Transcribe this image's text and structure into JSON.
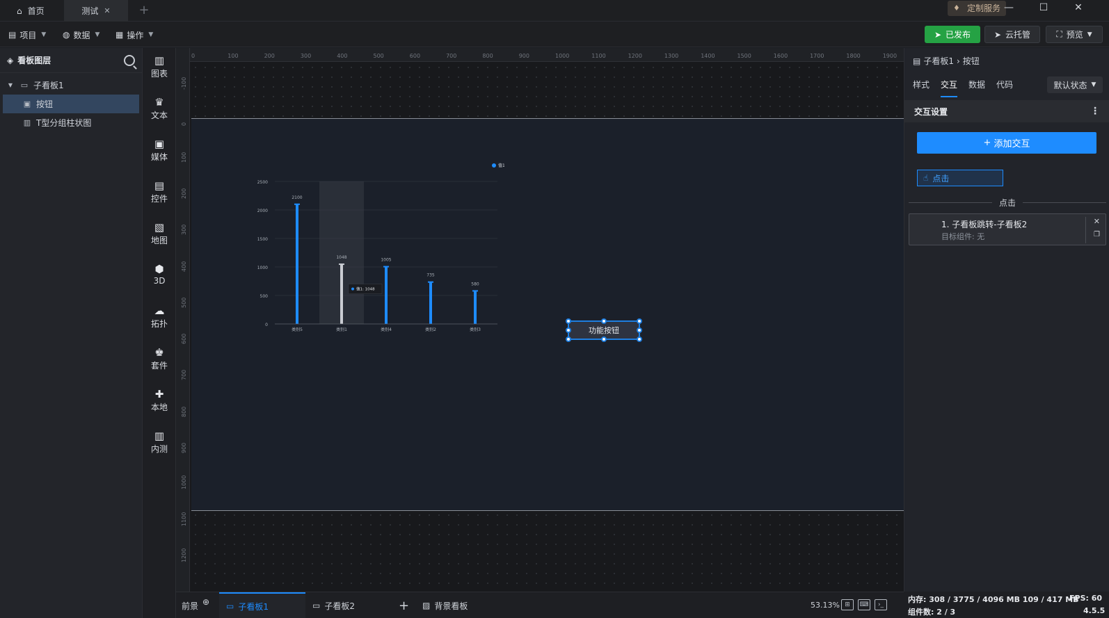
{
  "titlebar": {
    "home_tab": "首页",
    "active_tab": "测试",
    "close_glyph": "✕",
    "add_glyph": "+",
    "service_badge": "定制服务",
    "minimize_glyph": "—",
    "maximize_glyph": "☐",
    "close_window_glyph": "✕"
  },
  "toolbar": {
    "project": "项目",
    "data": "数据",
    "operate": "操作",
    "published": "已发布",
    "cloud": "云托管",
    "preview": "预览"
  },
  "layers": {
    "title": "看板图层",
    "items": [
      {
        "label": "子看板1",
        "level": 0
      },
      {
        "label": "按钮",
        "level": 1,
        "selected": true
      },
      {
        "label": "T型分组柱状图",
        "level": 1
      }
    ]
  },
  "rail": {
    "items": [
      {
        "label": "图表",
        "icon": "bar-chart-icon"
      },
      {
        "label": "文本",
        "icon": "text-icon"
      },
      {
        "label": "媒体",
        "icon": "media-icon"
      },
      {
        "label": "控件",
        "icon": "widget-icon"
      },
      {
        "label": "地图",
        "icon": "map-icon"
      },
      {
        "label": "3D",
        "icon": "cube-icon"
      },
      {
        "label": "拓扑",
        "icon": "topology-icon"
      },
      {
        "label": "套件",
        "icon": "kit-icon"
      },
      {
        "label": "本地",
        "icon": "puzzle-icon"
      },
      {
        "label": "内测",
        "icon": "beta-chart-icon"
      }
    ]
  },
  "ruler": {
    "top": [
      "0",
      "100",
      "200",
      "300",
      "400",
      "500",
      "600",
      "700",
      "800",
      "900",
      "1000",
      "1100",
      "1200",
      "1300",
      "1400",
      "1500",
      "1600",
      "1700",
      "1800",
      "1900"
    ],
    "left": [
      "-100",
      "0",
      "100",
      "200",
      "300",
      "400",
      "500",
      "600",
      "700",
      "800",
      "900",
      "1000",
      "1100",
      "1200"
    ]
  },
  "chart_data": {
    "type": "bar",
    "categories": [
      "类别5",
      "类别1",
      "类别4",
      "类别2",
      "类别3"
    ],
    "series": [
      {
        "name": "值1",
        "values": [
          2100,
          1048,
          1005,
          735,
          580
        ]
      }
    ],
    "ylim": [
      0,
      2500
    ],
    "yticks": [
      "0",
      "500",
      "1000",
      "1500",
      "2000",
      "2500"
    ],
    "data_labels": [
      "2100",
      "1048",
      "1005",
      "735",
      "580"
    ],
    "tooltip": {
      "series": "值1",
      "value": "1048"
    },
    "highlight_index": 1,
    "colors": {
      "bar": "#1e8cff",
      "highlight": "#c9ccd2",
      "grid": "#3a3e47"
    },
    "grid": true,
    "legend": "top-right"
  },
  "canvas": {
    "button_label": "功能按钮"
  },
  "bottom": {
    "foreground": "前景",
    "board1": "子看板1",
    "board2": "子看板2",
    "background": "背景看板",
    "zoom": "53.13%"
  },
  "props": {
    "breadcrumb_parent": "子看板1",
    "breadcrumb_sep": "›",
    "breadcrumb_current": "按钮",
    "tabs": [
      "样式",
      "交互",
      "数据",
      "代码"
    ],
    "state": "默认状态",
    "section": "交互设置",
    "add_interaction": "添加交互",
    "event": "点击",
    "divider": "点击",
    "action_title": "1. 子看板跳转-子看板2",
    "action_target": "目标组件: 无"
  },
  "status": {
    "memory_label": "内存:",
    "memory_value": "308 / 3775 / 4096 MB  109 / 417 MB",
    "fps_label": "FPS: 60",
    "components_label": "组件数: 2 / 3",
    "version": "4.5.5"
  },
  "colors": {
    "accent": "#1e8cff",
    "published": "#25a244",
    "selected_layer": "#33465f"
  }
}
